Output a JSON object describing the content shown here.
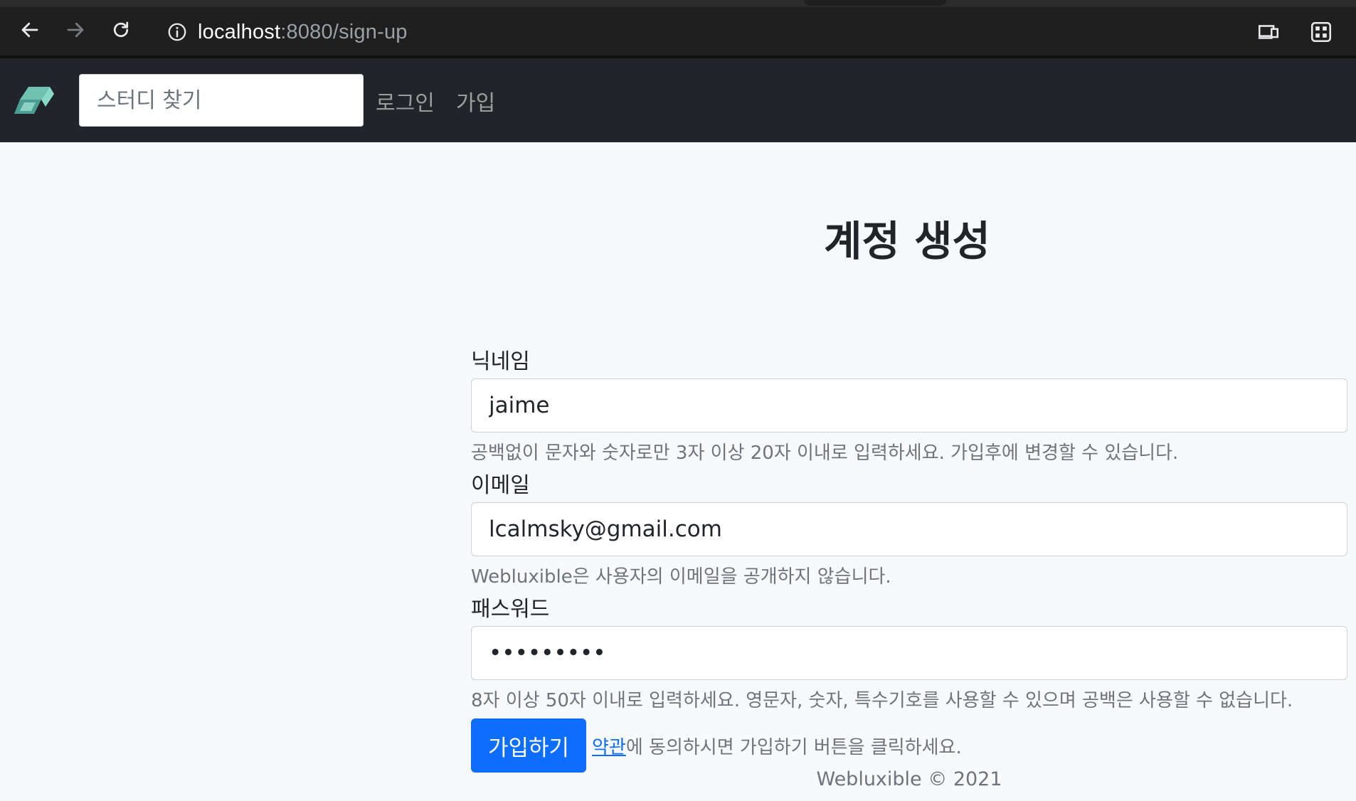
{
  "browser": {
    "url_host": "localhost",
    "url_path": ":8080/sign-up"
  },
  "navbar": {
    "search_placeholder": "스터디 찾기",
    "login_label": "로그인",
    "signup_label": "가입"
  },
  "page": {
    "title": "계정 생성"
  },
  "form": {
    "nickname": {
      "label": "닉네임",
      "value": "jaime",
      "help": "공백없이 문자와 숫자로만 3자 이상 20자 이내로 입력하세요. 가입후에 변경할 수 있습니다."
    },
    "email": {
      "label": "이메일",
      "value": "lcalmsky@gmail.com",
      "help": "Webluxible은 사용자의 이메일을 공개하지 않습니다."
    },
    "password": {
      "label": "패스워드",
      "value": "password1",
      "help": "8자 이상 50자 이내로 입력하세요. 영문자, 숫자, 특수기호를 사용할 수 있으며 공백은 사용할 수 없습니다."
    },
    "submit_label": "가입하기",
    "terms_link": "약관",
    "terms_note": "에 동의하시면 가입하기 버튼을 클릭하세요."
  },
  "footer": {
    "text": "Webluxible © 2021"
  },
  "colors": {
    "navbar_bg": "#212529",
    "primary": "#0d6efd",
    "page_bg": "#f8f9fa"
  }
}
